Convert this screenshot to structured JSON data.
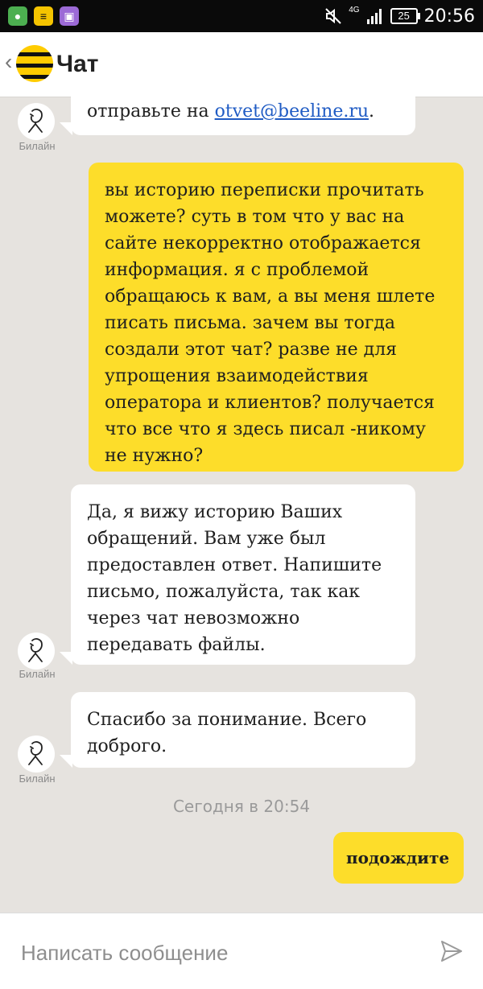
{
  "status_bar": {
    "network": "4G",
    "battery": "25",
    "time": "20:56"
  },
  "header": {
    "title": "Чат"
  },
  "messages": [
    {
      "direction": "in",
      "sender": "Билайн",
      "text_before_link": "отправьте на ",
      "link": "otvet@beeline.ru",
      "text_after_link": "."
    },
    {
      "direction": "out",
      "text": "вы историю переписки прочитать можете? суть в том что у вас на сайте некорректно отображается информация. я с проблемой обращаюсь к вам, а вы меня шлете писать письма. зачем вы тогда создали этот чат? разве не для упрощения взаимодействия оператора и клиентов? получается что все что я здесь писал -никому не нужно?"
    },
    {
      "direction": "in",
      "sender": "Билайн",
      "text": "Да, я вижу историю Ваших обращений. Вам уже был предоставлен ответ. Напишите письмо, пожалуйста, так как через чат невозможно передавать файлы."
    },
    {
      "direction": "in",
      "sender": "Билайн",
      "text": "Спасибо за понимание. Всего доброго."
    },
    {
      "direction": "out",
      "text": "подождите"
    }
  ],
  "timestamp": "Сегодня в 20:54",
  "composer": {
    "placeholder": "Написать сообщение"
  },
  "icons": {
    "back": "chevron-left-icon",
    "send": "send-icon",
    "avatar": "operator-avatar-icon"
  },
  "colors": {
    "brand_yellow": "#fddd2a",
    "background": "#e6e3df",
    "link": "#1f5bc4"
  }
}
